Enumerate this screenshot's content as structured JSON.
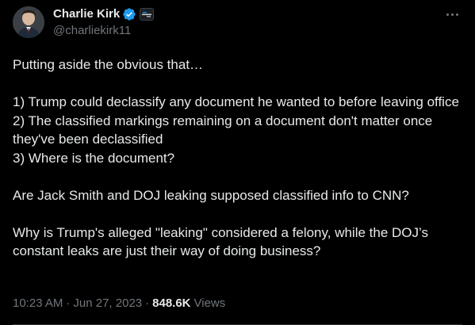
{
  "author": {
    "display_name": "Charlie Kirk",
    "handle": "@charliekirk11",
    "verified": true,
    "affiliation_badge": "organization-badge-icon"
  },
  "tweet": {
    "text": "Putting aside the obvious that…\n\n1) Trump could declassify any document he wanted to before leaving office\n2) The classified markings remaining on a document don't matter once they've been declassified\n3) Where is the document?\n\nAre Jack Smith and DOJ leaking supposed classified info to CNN?\n\nWhy is Trump's alleged \"leaking\" considered a felony, while the DOJ’s constant leaks are just their way of doing business?",
    "time": "10:23 AM",
    "date": "Jun 27, 2023",
    "separator": "·",
    "views_count": "848.6K",
    "views_label": "Views"
  },
  "icons": {
    "more": "more-horizontal-icon",
    "verified": "verified-badge-icon"
  },
  "colors": {
    "background": "#000000",
    "text": "#e7e9ea",
    "muted": "#71767b",
    "verified_blue": "#1d9bf0"
  }
}
